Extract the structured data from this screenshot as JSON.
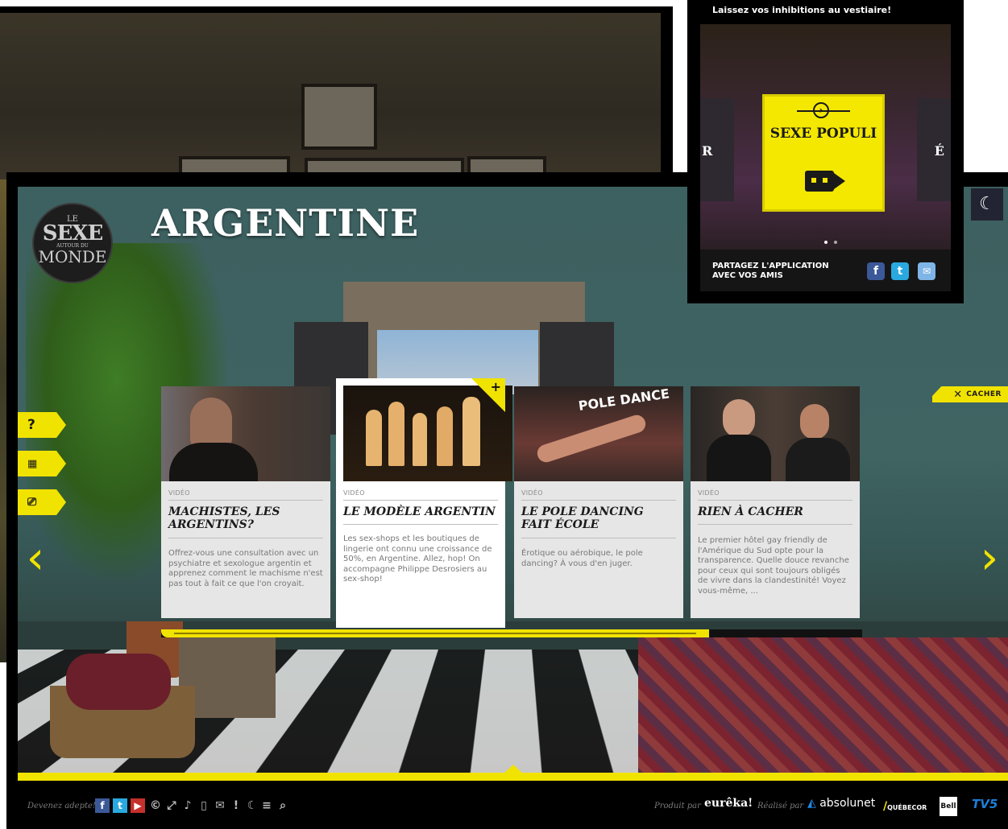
{
  "page": {
    "title": "ARGENTINE"
  },
  "logo": {
    "line1": "LE",
    "line2": "SEXE",
    "line3": "AUTOUR DU",
    "line4": "MONDE"
  },
  "side_tabs": [
    {
      "icon": "help-icon",
      "glyph": "?."
    },
    {
      "icon": "grid-icon",
      "glyph": "▦"
    },
    {
      "icon": "tv-icon",
      "glyph": "⌂"
    }
  ],
  "cacher_label": "CACHER",
  "cards": [
    {
      "tag": "VIDÉO",
      "title": "MACHISTES, LES ARGENTINS?",
      "desc": "Offrez-vous une consultation avec un psychiatre et sexologue argentin et apprenez comment le machisme n'est pas tout à fait ce que l'on croyait."
    },
    {
      "tag": "VIDÉO",
      "title": "LE MODÈLE ARGENTIN",
      "desc": "Les sex-shops et les boutiques de lingerie ont connu une croissance de 50%, en Argentine. Allez, hop! On accompagne Philippe Desrosiers au sex-shop!"
    },
    {
      "tag": "VIDÉO",
      "title": "LE POLE DANCING FAIT ÉCOLE",
      "desc": "Érotique ou aérobique, le pole dancing? À vous d'en juger."
    },
    {
      "tag": "VIDÉO",
      "title": "RIEN À CACHER",
      "desc": "Le premier hôtel gay friendly de l'Amérique du Sud opte pour la transparence. Quelle douce revanche pour ceux qui sont toujours obligés de vivre dans la clandestinité! Voyez vous-même, ..."
    }
  ],
  "thumb_sign": "POLE DANCE",
  "footer": {
    "adepte": "Devenez adepte!",
    "produit": "Produit par",
    "realise": "Réalisé par",
    "eureka": "eurêka!",
    "absolunet": "absolunet",
    "fonds": "QUÉBECOR",
    "bell": "Bell",
    "tv5": "TV5"
  },
  "popup": {
    "heading": "Laissez vos inhibitions au vestiaire!",
    "left_label": "R",
    "right_label": "É",
    "card_title": "SEXE POPULI",
    "share_text": "PARTAGEZ L'APPLICATION AVEC VOS AMIS"
  },
  "colors": {
    "accent": "#f1e300",
    "facebook": "#3b5998",
    "twitter": "#2aa9e0"
  }
}
